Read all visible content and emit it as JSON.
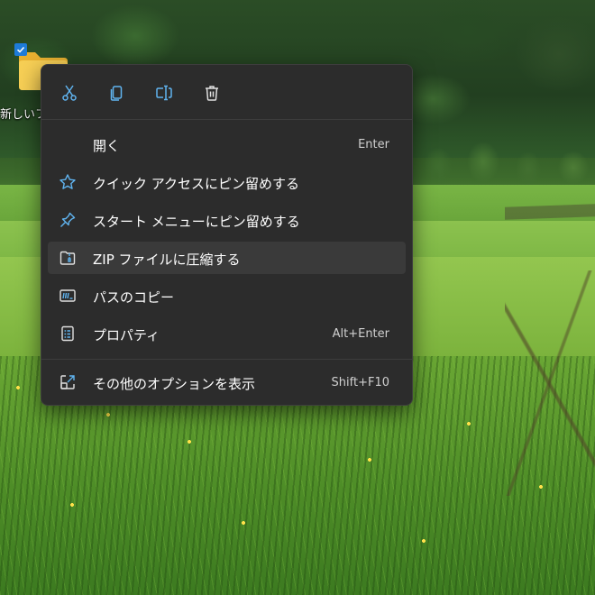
{
  "desktop": {
    "icon_label": "新しいフ",
    "checked": true,
    "folder_color": "#f4c542"
  },
  "context_menu": {
    "toolbar": [
      {
        "icon": "cut-icon",
        "action": "cut"
      },
      {
        "icon": "copy-icon",
        "action": "copy"
      },
      {
        "icon": "rename-icon",
        "action": "rename"
      },
      {
        "icon": "delete-icon",
        "action": "delete"
      }
    ],
    "items": [
      {
        "label": "開く",
        "accelerator": "Enter",
        "icon": "none"
      },
      {
        "label": "クイック アクセスにピン留めする",
        "accelerator": "",
        "icon": "star-icon"
      },
      {
        "label": "スタート メニューにピン留めする",
        "accelerator": "",
        "icon": "pin-icon"
      },
      {
        "label": "ZIP ファイルに圧縮する",
        "accelerator": "",
        "icon": "zip-icon",
        "highlighted": true
      },
      {
        "label": "パスのコピー",
        "accelerator": "",
        "icon": "copy-path-icon"
      },
      {
        "label": "プロパティ",
        "accelerator": "Alt+Enter",
        "icon": "properties-icon"
      },
      {
        "label": "その他のオプションを表示",
        "accelerator": "Shift+F10",
        "icon": "more-options-icon"
      }
    ]
  },
  "colors": {
    "menu_bg": "#2c2c2c",
    "hover_bg": "#3a3a3a",
    "icon_accent": "#60b4f0",
    "separator": "#3d3d3d"
  }
}
